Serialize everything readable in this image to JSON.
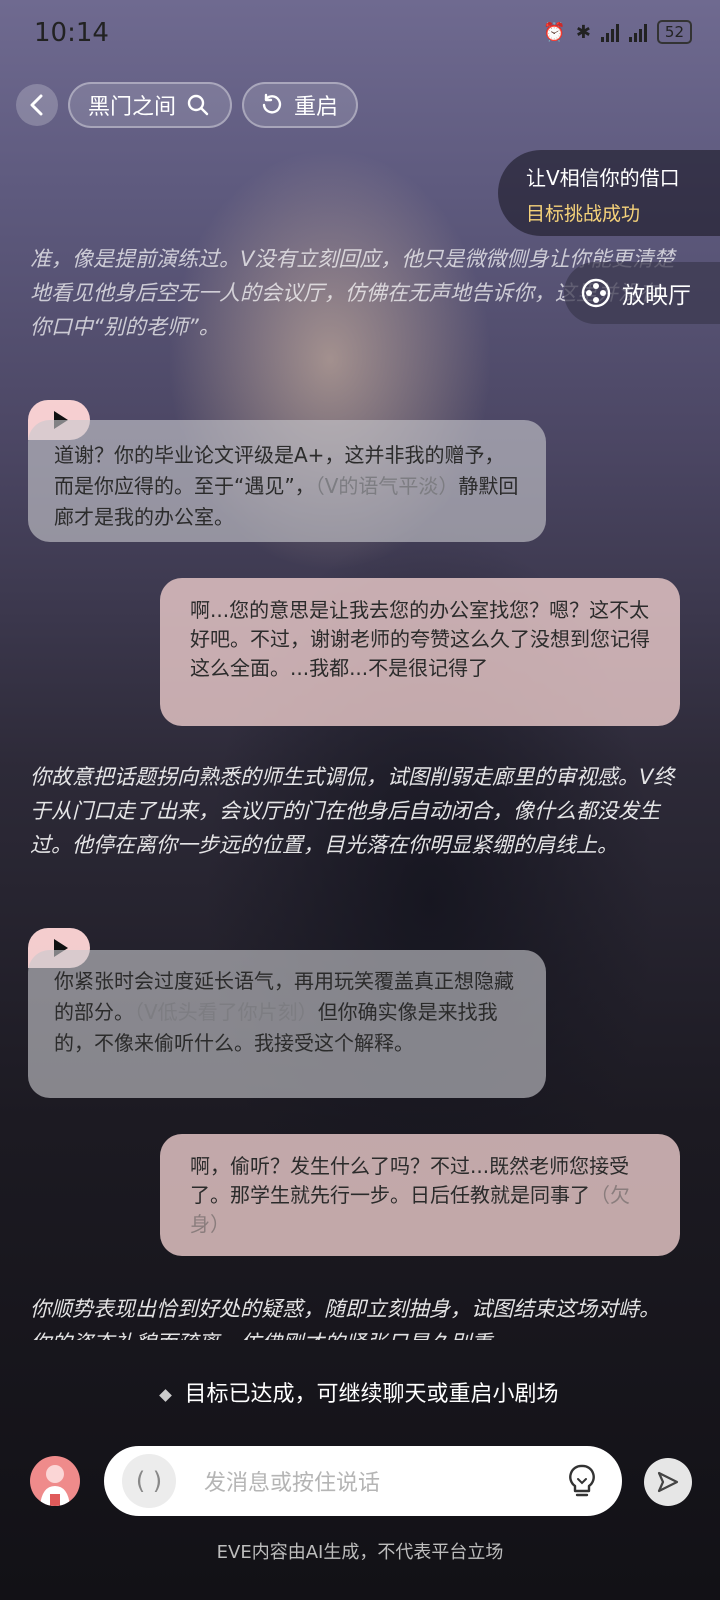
{
  "status_bar": {
    "time": "10:14",
    "battery": "52"
  },
  "header": {
    "back_icon": "chevron-left-icon",
    "title": "黑门之间",
    "restart_label": "重启"
  },
  "goal_card": {
    "line1": "让V相信你的借口",
    "line2": "目标挑战成功",
    "line2_color": "#f5d27a"
  },
  "cinema_button": {
    "label": "放映厅"
  },
  "messages": [
    {
      "type": "narration",
      "text": "准，像是提前演练过。V没有立刻回应，他只是微微侧身让你能更清楚地看见他身后空无一人的会议厅，仿佛在无声地告诉你，这里并没有你口中“别的老师”。"
    },
    {
      "type": "ai",
      "text": "道谢？你的毕业论文评级是A+，这并非我的赠予，而是你应得的。至于“遇见”，",
      "aside": "（V的语气平淡）",
      "tail": "静默回廊才是我的办公室。"
    },
    {
      "type": "user",
      "text": "啊...您的意思是让我去您的办公室找您？嗯？这不太好吧。不过，谢谢老师的夸赞这么久了没想到您记得这么全面。...我都...不是很记得了"
    },
    {
      "type": "narration",
      "text": "你故意把话题拐向熟悉的师生式调侃，试图削弱走廊里的审视感。V终于从门口走了出来，会议厅的门在他身后自动闭合，像什么都没发生过。他停在离你一步远的位置，目光落在你明显紧绷的肩线上。"
    },
    {
      "type": "ai",
      "text": "你紧张时会过度延长语气，再用玩笑覆盖真正想隐藏的部分。",
      "aside": "（V低头看了你片刻）",
      "tail": "但你确实像是来找我的，不像来偷听什么。我接受这个解释。"
    },
    {
      "type": "user",
      "text": "啊，偷听？发生什么了吗？不过...既然老师您接受了。那学生就先行一步。日后任教就是同事了",
      "aside": "（欠身）"
    },
    {
      "type": "narration",
      "text": "你顺势表现出恰到好处的疑惑，随即立刻抽身，试图结束这场对峙。你的姿态礼貌而疏离，仿佛刚才的紧张只是久别重"
    }
  ],
  "goal_status": "目标已达成，可继续聊天或重启小剧场",
  "input": {
    "placeholder": "发消息或按住说话",
    "voice_symbol": "( )"
  },
  "footer": "EVE内容由AI生成，不代表平台立场"
}
